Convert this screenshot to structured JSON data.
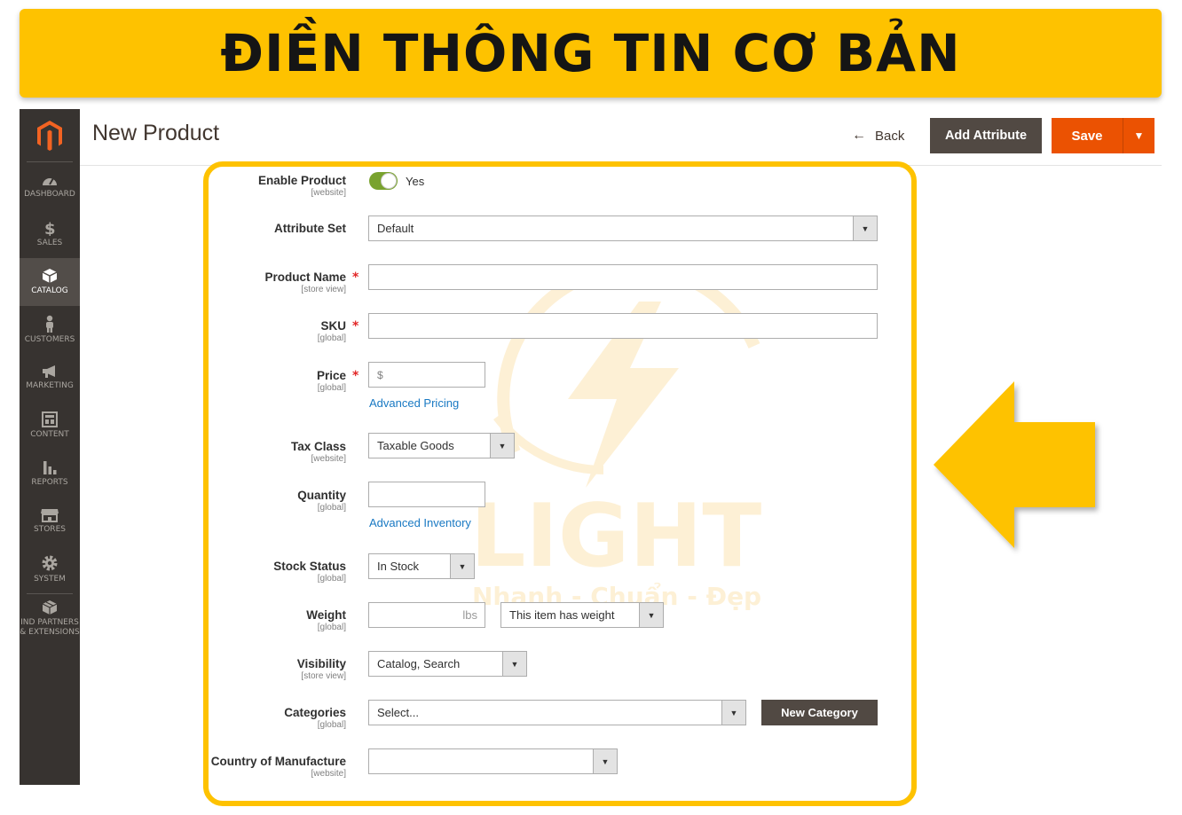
{
  "banner": {
    "title": "ĐIỀN THÔNG TIN CƠ BẢN"
  },
  "sidebar": {
    "items": [
      {
        "label": "DASHBOARD",
        "icon": "dashboard-icon"
      },
      {
        "label": "SALES",
        "icon": "dollar-icon"
      },
      {
        "label": "CATALOG",
        "icon": "box-icon",
        "active": true
      },
      {
        "label": "CUSTOMERS",
        "icon": "person-icon"
      },
      {
        "label": "MARKETING",
        "icon": "megaphone-icon"
      },
      {
        "label": "CONTENT",
        "icon": "layout-icon"
      },
      {
        "label": "REPORTS",
        "icon": "bar-chart-icon"
      },
      {
        "label": "STORES",
        "icon": "store-icon"
      },
      {
        "label": "SYSTEM",
        "icon": "gear-icon"
      },
      {
        "label": "IND PARTNERS\n& EXTENSIONS",
        "icon": "cubes-icon"
      }
    ]
  },
  "header": {
    "title": "New Product",
    "back_label": "Back",
    "add_attribute_label": "Add Attribute",
    "save_label": "Save"
  },
  "form": {
    "enable_product": {
      "label": "Enable Product",
      "scope": "[website]",
      "value": "Yes"
    },
    "attribute_set": {
      "label": "Attribute Set",
      "value": "Default"
    },
    "product_name": {
      "label": "Product Name",
      "scope": "[store view]",
      "value": ""
    },
    "sku": {
      "label": "SKU",
      "scope": "[global]",
      "value": ""
    },
    "price": {
      "label": "Price",
      "scope": "[global]",
      "prefix": "$",
      "value": "",
      "link": "Advanced Pricing"
    },
    "tax_class": {
      "label": "Tax Class",
      "scope": "[website]",
      "value": "Taxable Goods"
    },
    "quantity": {
      "label": "Quantity",
      "scope": "[global]",
      "value": "",
      "link": "Advanced Inventory"
    },
    "stock_status": {
      "label": "Stock Status",
      "scope": "[global]",
      "value": "In Stock"
    },
    "weight": {
      "label": "Weight",
      "scope": "[global]",
      "unit": "lbs",
      "value": "",
      "type_value": "This item has weight"
    },
    "visibility": {
      "label": "Visibility",
      "scope": "[store view]",
      "value": "Catalog, Search"
    },
    "categories": {
      "label": "Categories",
      "scope": "[global]",
      "placeholder": "Select...",
      "new_button": "New Category"
    },
    "country": {
      "label": "Country of Manufacture",
      "scope": "[website]",
      "value": ""
    }
  },
  "watermark": {
    "brand": "LIGHT",
    "slogan": "Nhanh - Chuẩn - Đẹp"
  },
  "colors": {
    "banner": "#fec200",
    "sidebar": "#373330",
    "accent_orange": "#eb5202",
    "dark_button": "#514943",
    "link": "#1979c3",
    "toggle_on": "#79a22e"
  }
}
